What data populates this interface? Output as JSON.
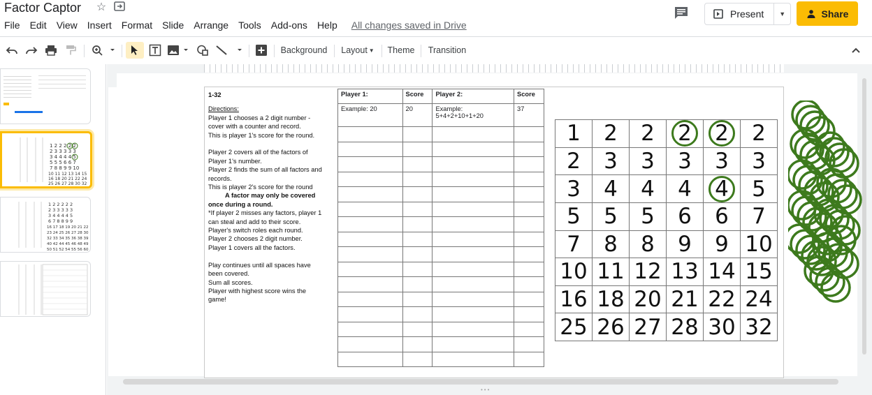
{
  "title": "Factor Captor",
  "menu": [
    "File",
    "Edit",
    "View",
    "Insert",
    "Format",
    "Slide",
    "Arrange",
    "Tools",
    "Add-ons",
    "Help"
  ],
  "save_status": "All changes saved in Drive",
  "present_label": "Present",
  "share_label": "Share",
  "toolbar": {
    "background_label": "Background",
    "layout_label": "Layout",
    "theme_label": "Theme",
    "transition_label": "Transition"
  },
  "slide": {
    "range_label": "1-32",
    "directions_heading": "Directions:",
    "directions_lines": [
      "Player 1 chooses a 2 digit number -",
      "cover with a counter and record.",
      "This is player 1's score for the round.",
      "",
      "Player 2 covers all of the factors of",
      "Player 1's number.",
      "Player 2 finds the sum of all factors and",
      "records.",
      "This is player 2's score for the round"
    ],
    "bold_note_1": "A factor may only be covered",
    "bold_note_2": "once during a round.",
    "directions_lines_2": [
      "*If player 2 misses any factors, player 1",
      "can steal and add to their score.",
      "Player's switch roles each round.",
      "Player 2 chooses 2 digit number.",
      "Player 1 covers all the factors.",
      "",
      "Play continues until all spaces have",
      "been covered.",
      "Sum all scores.",
      "Player with highest score wins the",
      "game!"
    ],
    "table": {
      "headers": [
        "Player 1:",
        "Score",
        "Player 2:",
        "Score"
      ],
      "example": [
        "Example: 20",
        "20",
        "Example:",
        "37"
      ],
      "example_sum": "5+4+2+10+1+20"
    },
    "grid": [
      [
        "1",
        "2",
        "2",
        "2",
        "2",
        "2"
      ],
      [
        "2",
        "3",
        "3",
        "3",
        "3",
        "3"
      ],
      [
        "3",
        "4",
        "4",
        "4",
        "4",
        "5"
      ],
      [
        "5",
        "5",
        "5",
        "6",
        "6",
        "7"
      ],
      [
        "7",
        "8",
        "8",
        "9",
        "9",
        "10"
      ],
      [
        "10",
        "11",
        "12",
        "13",
        "14",
        "15"
      ],
      [
        "16",
        "18",
        "20",
        "21",
        "22",
        "24"
      ],
      [
        "25",
        "26",
        "27",
        "28",
        "30",
        "32"
      ]
    ],
    "circled_cells": [
      "0-3",
      "0-4",
      "2-4"
    ],
    "counter_color": "#3d7a1d"
  },
  "colors": {
    "share_bg": "#fbbc04",
    "select_bg": "#feefc3"
  }
}
